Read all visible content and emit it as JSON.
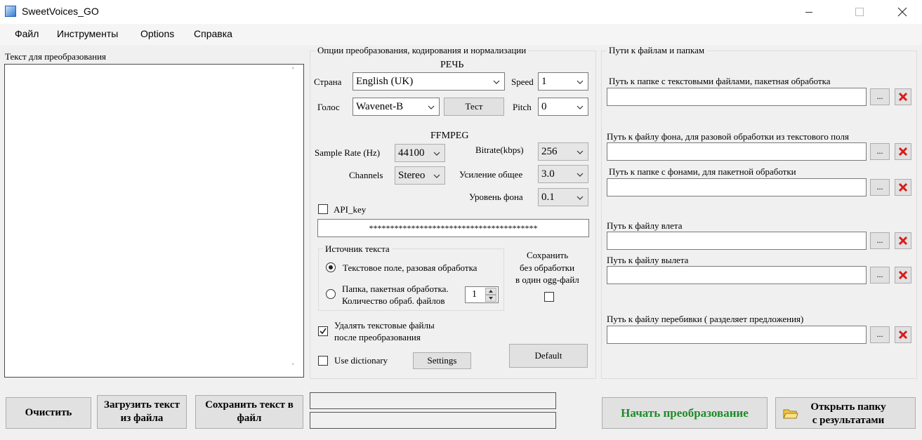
{
  "window": {
    "title": "SweetVoices_GO"
  },
  "menu": [
    "Файл",
    "Инструменты",
    "Options",
    "Справка"
  ],
  "left": {
    "text_label": "Текст для преобразования"
  },
  "options": {
    "group_title": "Опции преобразования, кодирования и нормализации",
    "speech_header": "РЕЧЬ",
    "country_label": "Страна",
    "country_value": "English (UK)",
    "speed_label": "Speed",
    "speed_value": "1",
    "voice_label": "Голос",
    "voice_value": "Wavenet-B",
    "test_button": "Тест",
    "pitch_label": "Pitch",
    "pitch_value": "0",
    "ffmpeg_header": "FFMPEG",
    "sample_rate_label": "Sample Rate (Hz)",
    "sample_rate_value": "44100",
    "bitrate_label": "Bitrate(kbps)",
    "bitrate_value": "256",
    "channels_label": "Channels",
    "channels_value": "Stereo",
    "gain_label": "Усиление общее",
    "gain_value": "3.0",
    "bg_level_label": "Уровень фона",
    "bg_level_value": "0.1",
    "api_key_label": "API_key",
    "api_key_value": "****************************************",
    "source_group_title": "Источник текста",
    "radio_text_field": "Текстовое поле, разовая обработка",
    "radio_folder_line1": "Папка, пакетная обработка.",
    "radio_folder_line2": "Количество обраб. файлов",
    "file_count_value": "1",
    "save_line1": "Сохранить",
    "save_line2": "без обработки",
    "save_line3": "в один ogg-файл",
    "delete_files_line1": "Удалять текстовые файлы",
    "delete_files_line2": "после преобразования",
    "use_dictionary_label": "Use dictionary",
    "settings_button": "Settings",
    "default_button": "Default"
  },
  "paths": {
    "group_title": "Пути к файлам и папкам",
    "items": [
      {
        "label": "Путь к папке с текстовыми файлами, пакетная обработка",
        "value": ""
      },
      {
        "label": "Путь к файлу фона, для разовой обработки из текстового поля",
        "value": ""
      },
      {
        "label": "Путь к папке с фонами, для пакетной обработки",
        "value": ""
      },
      {
        "label": "Путь к файлу влета",
        "value": ""
      },
      {
        "label": "Путь к файлу вылета",
        "value": ""
      },
      {
        "label": "Путь к файлу перебивки ( разделяет предложения)",
        "value": ""
      }
    ],
    "browse_label": "..."
  },
  "bottom": {
    "clear_button": "Очистить",
    "load_line1": "Загрузить текст",
    "load_line2": "из файла",
    "save_line1": "Сохранить текст в",
    "save_line2": "файл",
    "status1": "",
    "status2": "",
    "start_button": "Начать преобразование",
    "open_line1": "Открыть папку",
    "open_line2": "с результатами"
  },
  "colors": {
    "start_text": "#1e8c2a",
    "delete_x": "#d81b1b"
  }
}
